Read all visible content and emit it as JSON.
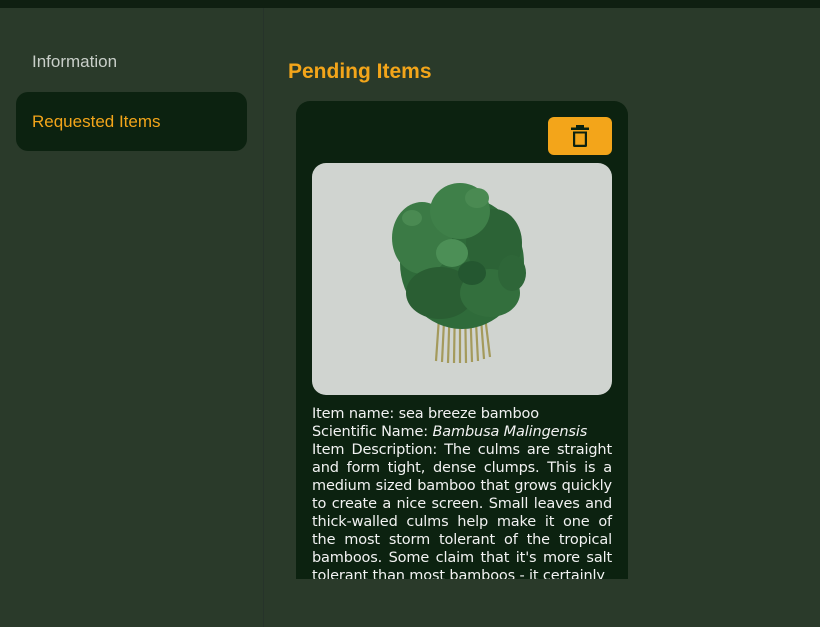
{
  "sidebar": {
    "items": [
      {
        "label": "Information"
      },
      {
        "label": "Requested Items"
      }
    ]
  },
  "main": {
    "title": "Pending Items",
    "card": {
      "delete_icon": "trash-icon",
      "name_prefix": "Item name: ",
      "name": "sea breeze bamboo",
      "sci_prefix": "Scientific Name: ",
      "sci_name": "Bambusa Malingensis",
      "desc_prefix": "Item Description: ",
      "description": "The culms are straight and form tight, dense clumps. This is a medium sized bamboo that grows quickly to create a nice screen. Small leaves and thick-walled culms help make it one of the most storm tolerant of the tropical bamboos. Some claim that it's more salt tolerant than most bamboos - it certainly"
    }
  },
  "colors": {
    "background": "#2a3a2a",
    "card": "#0c2210",
    "accent": "#f3a51a"
  }
}
